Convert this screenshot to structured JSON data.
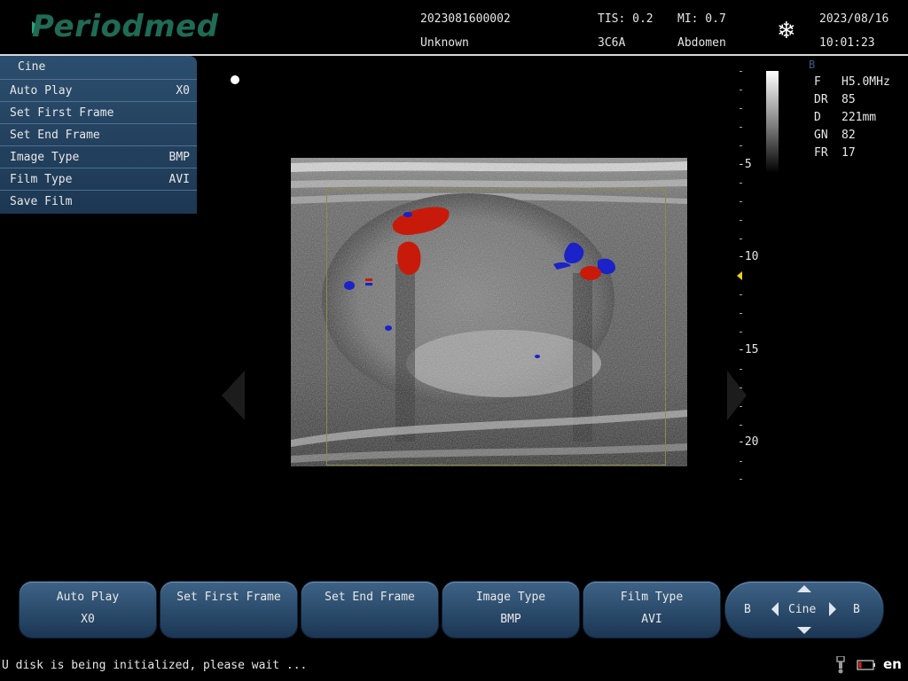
{
  "header": {
    "logo": "Periodmed",
    "patient_id": "2023081600002",
    "patient_name": "Unknown",
    "tis": "TIS: 0.2",
    "mi": "MI: 0.7",
    "probe": "3C6A",
    "exam": "Abdomen",
    "date": "2023/08/16",
    "time": "10:01:23",
    "freeze_icon": "snowflake-icon"
  },
  "cine_menu": {
    "title": "Cine",
    "items": [
      {
        "label": "Auto Play",
        "value": "X0"
      },
      {
        "label": "Set First Frame",
        "value": ""
      },
      {
        "label": "Set End Frame",
        "value": ""
      },
      {
        "label": "Image Type",
        "value": "BMP"
      },
      {
        "label": "Film Type",
        "value": "AVI"
      },
      {
        "label": "Save Film",
        "value": ""
      }
    ]
  },
  "depth_scale": {
    "labels": [
      "-5",
      "-10",
      "-15",
      "-20"
    ]
  },
  "params": {
    "mode": "B",
    "rows": [
      {
        "key": "F",
        "value": "H5.0MHz"
      },
      {
        "key": "DR",
        "value": "85"
      },
      {
        "key": "D",
        "value": "221mm"
      },
      {
        "key": "GN",
        "value": "82"
      },
      {
        "key": "FR",
        "value": "17"
      }
    ]
  },
  "softkeys": [
    {
      "label": "Auto Play",
      "value": "X0"
    },
    {
      "label": "Set First Frame",
      "value": ""
    },
    {
      "label": "Set End Frame",
      "value": ""
    },
    {
      "label": "Image Type",
      "value": "BMP"
    },
    {
      "label": "Film Type",
      "value": "AVI"
    }
  ],
  "nav": {
    "left": "B",
    "center": "Cine",
    "right": "B"
  },
  "status": {
    "message": "U disk is being initialized, please wait ...",
    "language": "en"
  },
  "colors": {
    "menu_bg": "#1c3752",
    "logo": "#1f6b55",
    "doppler_red": "#c81a0a",
    "doppler_blue": "#1a22c8",
    "focus_marker": "#e8d020"
  }
}
